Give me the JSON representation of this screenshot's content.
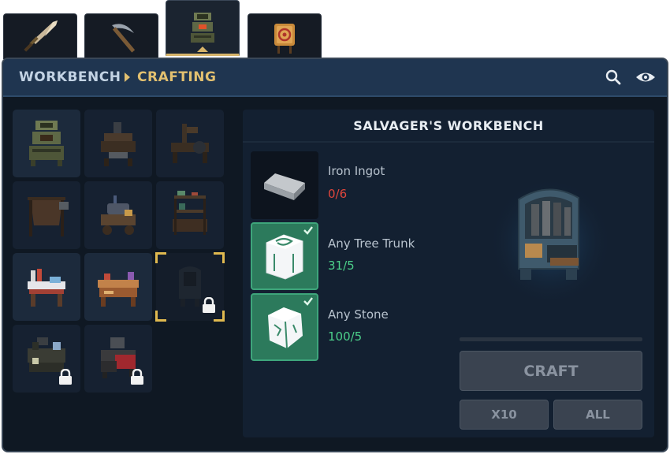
{
  "tabs": [
    {
      "name": "weapons",
      "icon": "dagger-icon"
    },
    {
      "name": "tools",
      "icon": "pickaxe-icon"
    },
    {
      "name": "workbenches",
      "icon": "workbench-icon",
      "active": true
    },
    {
      "name": "decorations",
      "icon": "target-icon"
    }
  ],
  "header": {
    "breadcrumb": [
      "WORKBENCH",
      "CRAFTING"
    ],
    "icons": [
      "search-icon",
      "eye-icon"
    ]
  },
  "grid": {
    "slots": [
      {
        "item": "basic-workbench",
        "locked": false
      },
      {
        "item": "anvil-station",
        "locked": false
      },
      {
        "item": "sawmill",
        "locked": false
      },
      {
        "item": "tanning-rack",
        "locked": false
      },
      {
        "item": "cooking-cart",
        "locked": false
      },
      {
        "item": "alchemy-shelf",
        "locked": false
      },
      {
        "item": "tailor-table",
        "locked": false
      },
      {
        "item": "carpenter-bench",
        "locked": false
      },
      {
        "item": "salvagers-workbench",
        "locked": true,
        "selected": true
      },
      {
        "item": "tinker-station",
        "locked": true
      },
      {
        "item": "forge",
        "locked": true
      }
    ]
  },
  "recipe": {
    "title": "SALVAGER'S WORKBENCH",
    "ingredients": [
      {
        "name": "Iron Ingot",
        "count": "0/6",
        "satisfied": false,
        "icon": "iron-ingot-icon"
      },
      {
        "name": "Any Tree Trunk",
        "count": "31/5",
        "satisfied": true,
        "icon": "tree-trunk-icon"
      },
      {
        "name": "Any Stone",
        "count": "100/5",
        "satisfied": true,
        "icon": "stone-icon"
      }
    ],
    "progress": 0,
    "buttons": {
      "craft": "CRAFT",
      "x10": "X10",
      "all": "ALL"
    }
  },
  "colors": {
    "accent": "#e2c070",
    "count_bad": "#e0463c",
    "count_ok": "#4cd08a",
    "panel_bg": "#0f1823",
    "header_bg": "#1f3550"
  }
}
